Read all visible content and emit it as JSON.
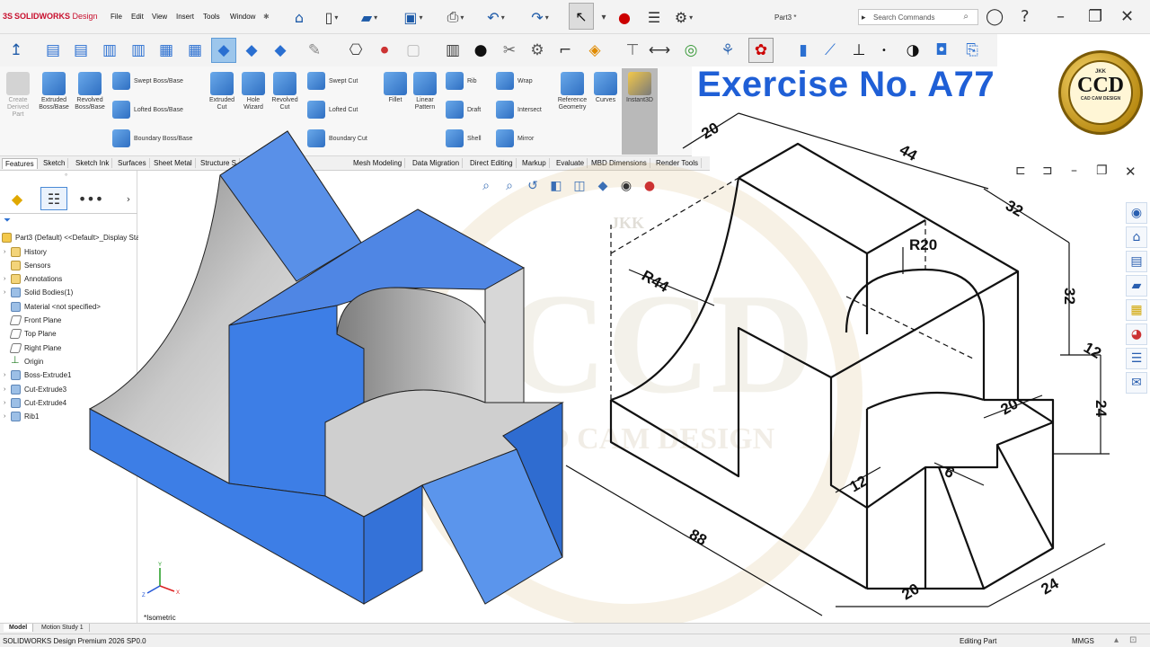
{
  "app": {
    "logo_brand": "SOLIDWORKS",
    "logo_product": "Design",
    "document_title": "Part3 *"
  },
  "menu": [
    "File",
    "Edit",
    "View",
    "Insert",
    "Tools",
    "Window"
  ],
  "search": {
    "placeholder": "Search Commands"
  },
  "command_manager": {
    "create_derived_part": "Create Derived Part",
    "extruded_boss": "Extruded Boss/Base",
    "revolved_boss": "Revolved Boss/Base",
    "swept_boss": "Swept Boss/Base",
    "lofted_boss": "Lofted Boss/Base",
    "boundary_boss": "Boundary Boss/Base",
    "extruded_cut": "Extruded Cut",
    "hole_wizard": "Hole Wizard",
    "revolved_cut": "Revolved Cut",
    "swept_cut": "Swept Cut",
    "lofted_cut": "Lofted Cut",
    "boundary_cut": "Boundary Cut",
    "fillet": "Fillet",
    "linear_pattern": "Linear Pattern",
    "rib": "Rib",
    "draft": "Draft",
    "shell": "Shell",
    "wrap": "Wrap",
    "intersect": "Intersect",
    "mirror": "Mirror",
    "reference_geometry": "Reference Geometry",
    "curves": "Curves",
    "instant3d": "Instant3D"
  },
  "tabs": [
    "Features",
    "Sketch",
    "Sketch Ink",
    "Surfaces",
    "Sheet Metal",
    "Structure S",
    "Mesh Modeling",
    "Data Migration",
    "Direct Editing",
    "Markup",
    "Evaluate",
    "MBD Dimensions",
    "Render Tools"
  ],
  "active_tab": "Features",
  "feature_tree": {
    "root": "Part3 (Default) <<Default>_Display Sta",
    "items": [
      {
        "label": "History",
        "kind": "folder",
        "expand": true
      },
      {
        "label": "Sensors",
        "kind": "folder",
        "expand": false
      },
      {
        "label": "Annotations",
        "kind": "folder",
        "expand": true
      },
      {
        "label": "Solid Bodies(1)",
        "kind": "body",
        "expand": true
      },
      {
        "label": "Material <not specified>",
        "kind": "material",
        "expand": false
      },
      {
        "label": "Front Plane",
        "kind": "plane",
        "expand": false
      },
      {
        "label": "Top Plane",
        "kind": "plane",
        "expand": false
      },
      {
        "label": "Right Plane",
        "kind": "plane",
        "expand": false
      },
      {
        "label": "Origin",
        "kind": "origin",
        "expand": false
      },
      {
        "label": "Boss-Extrude1",
        "kind": "feature",
        "expand": true
      },
      {
        "label": "Cut-Extrude3",
        "kind": "feature",
        "expand": true
      },
      {
        "label": "Cut-Extrude4",
        "kind": "feature",
        "expand": true
      },
      {
        "label": "Rib1",
        "kind": "feature",
        "expand": true
      }
    ]
  },
  "viewport": {
    "view_label": "*Isometric",
    "overlay_title": "Exercise No. A77",
    "logo": {
      "top": "JKK",
      "main": "CCD",
      "bottom": "CAD CAM DESIGN"
    },
    "watermark": {
      "top": "JKK",
      "main": "CCD",
      "bottom": "CAD CAM DESIGN"
    }
  },
  "drawing_dimensions": [
    "20",
    "44",
    "32",
    "R20",
    "R44",
    "32",
    "12",
    "24",
    "20",
    "6",
    "12",
    "88",
    "20",
    "24"
  ],
  "bottom_tabs": [
    "Model",
    "Motion Study 1"
  ],
  "status": {
    "product": "SOLIDWORKS Design Premium 2026 SP0.0",
    "mode": "Editing Part",
    "units": "MMGS"
  },
  "colors": {
    "model_blue": "#3d7ee6",
    "model_gray": "#c4c4c4",
    "title_blue": "#1f5fd6"
  }
}
